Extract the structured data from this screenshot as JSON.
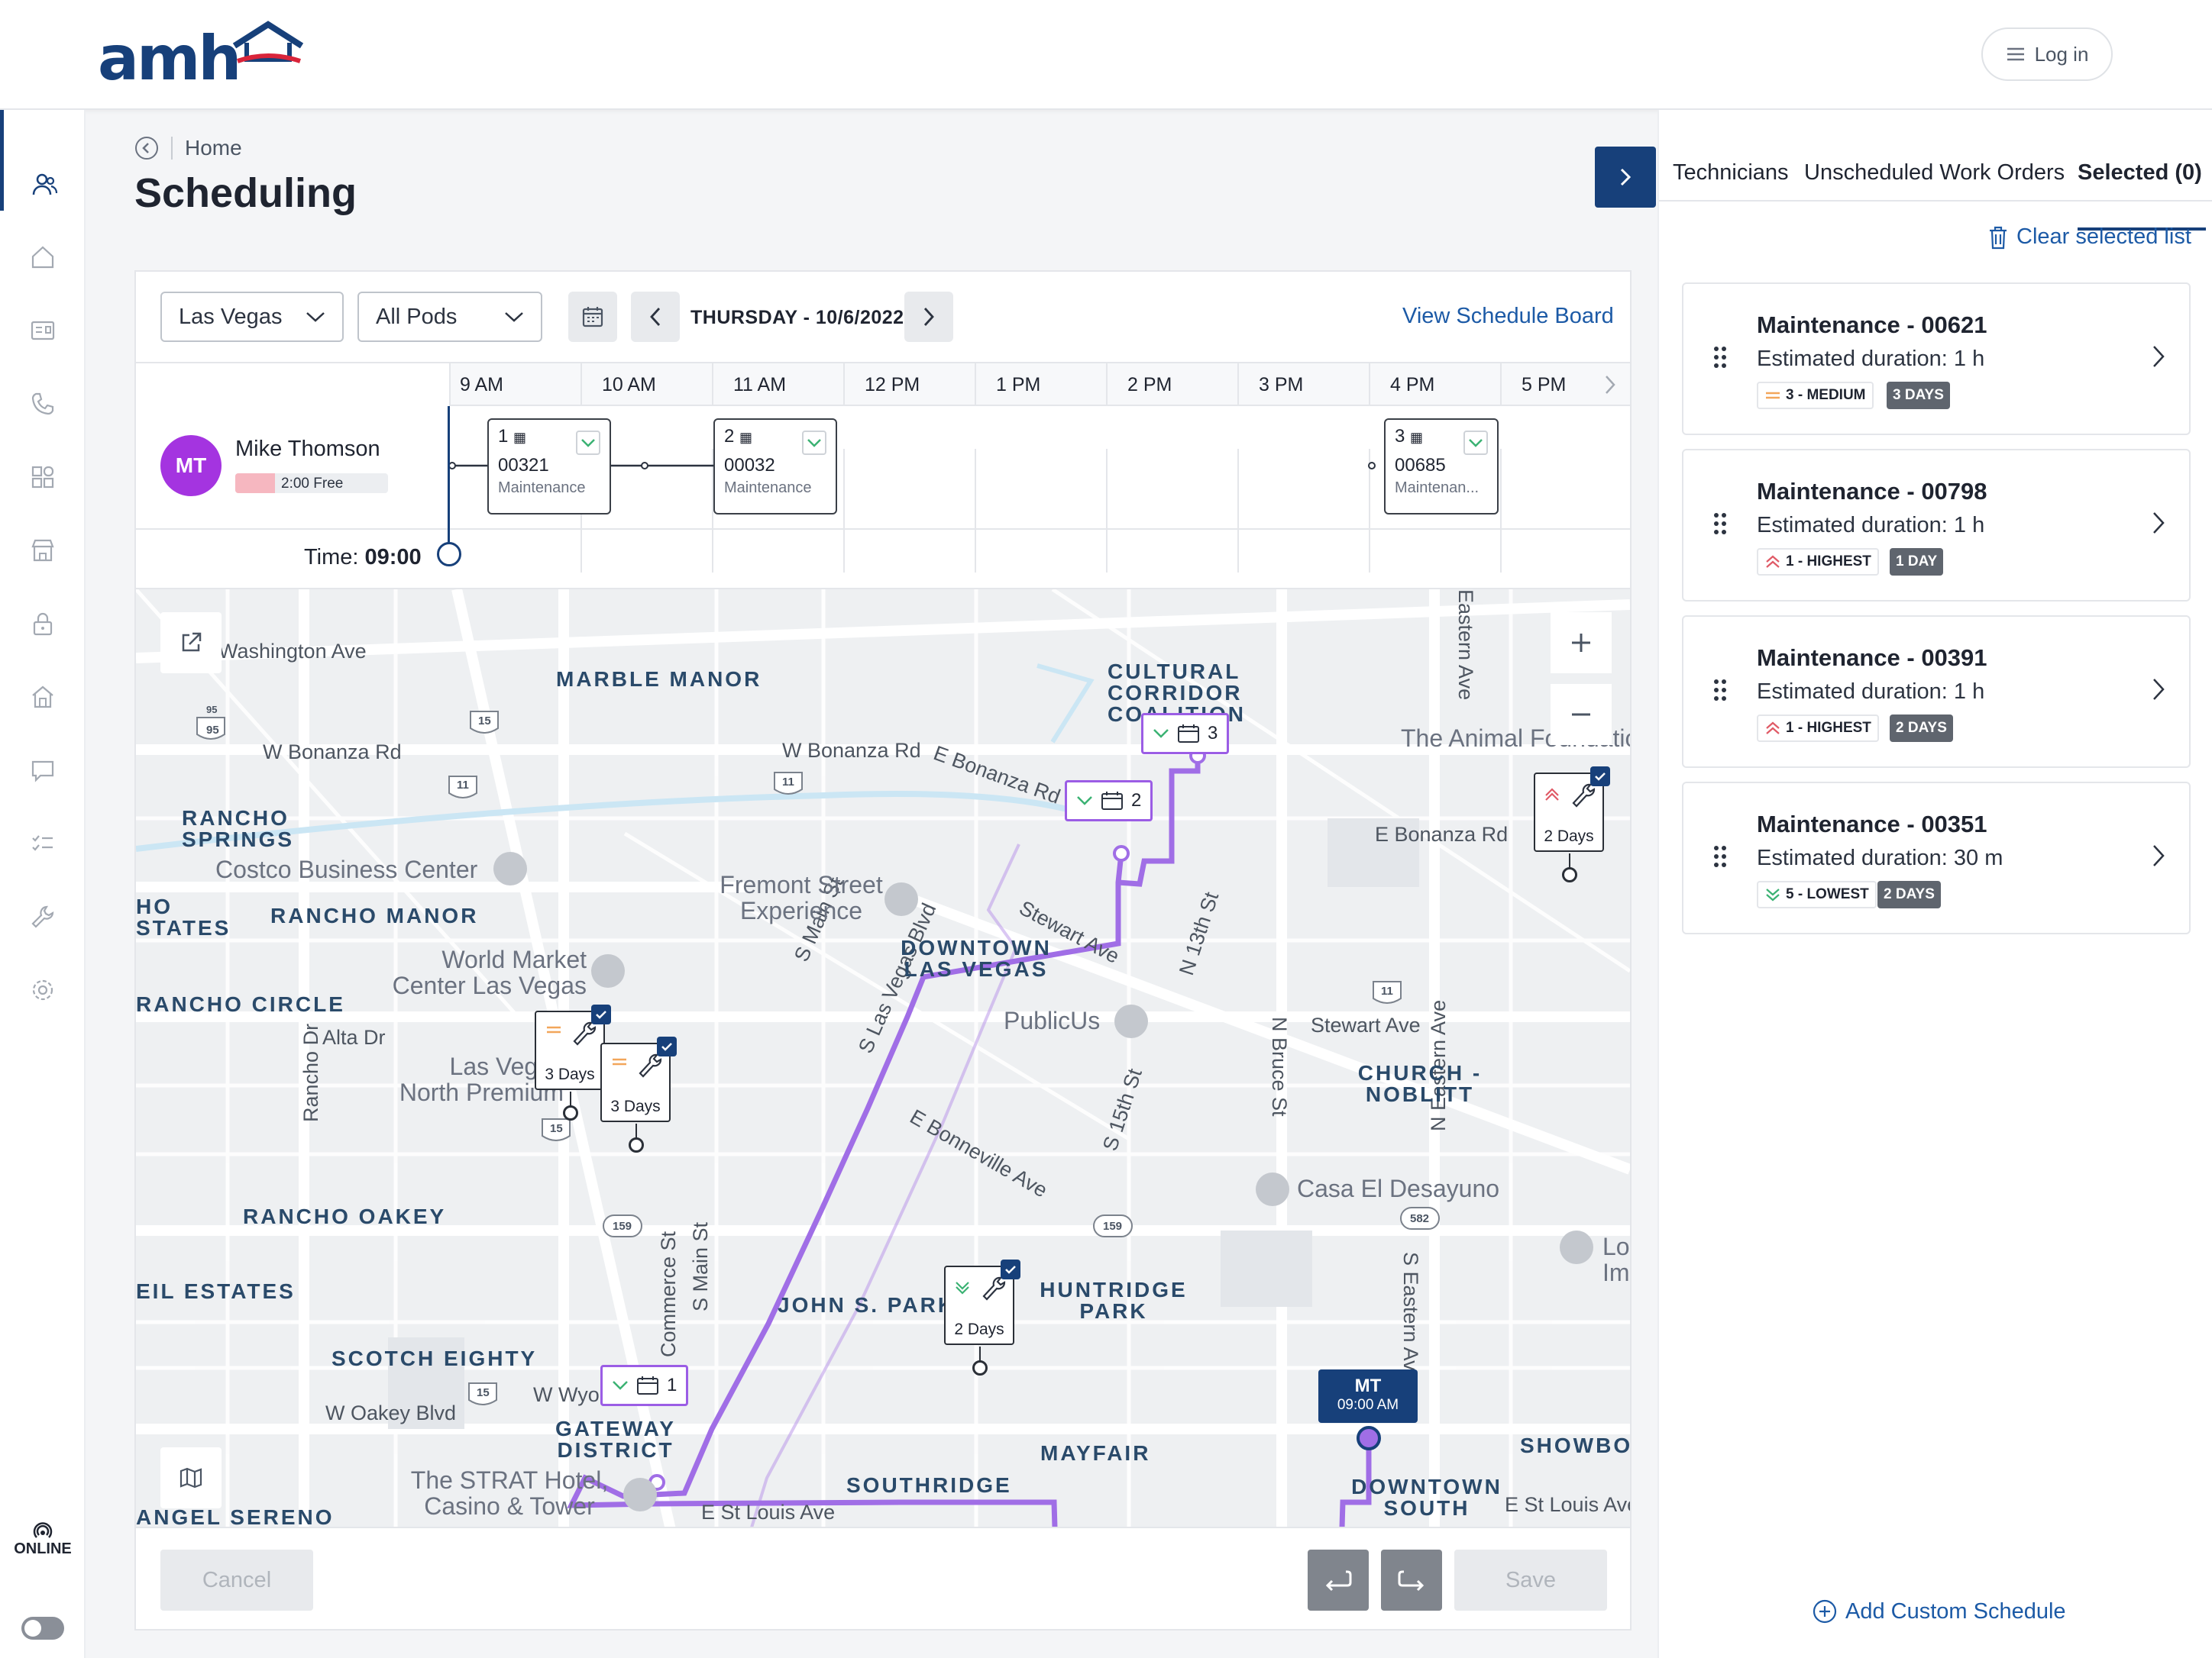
{
  "header": {
    "logo_text": "amh",
    "login_label": "Log in"
  },
  "breadcrumb": {
    "home": "Home"
  },
  "page_title": "Scheduling",
  "filters": {
    "location": "Las Vegas",
    "pods": "All Pods",
    "date": "THURSDAY - 10/6/2022",
    "view_board": "View Schedule Board"
  },
  "timeline": {
    "hours": [
      "9 AM",
      "10 AM",
      "11 AM",
      "12 PM",
      "1 PM",
      "2 PM",
      "3 PM",
      "4 PM",
      "5 PM"
    ],
    "technician": {
      "initials": "MT",
      "name": "Mike Thomson",
      "free": "2:00 Free"
    },
    "jobs": [
      {
        "num": "1",
        "code": "00321",
        "type": "Maintenance"
      },
      {
        "num": "2",
        "code": "00032",
        "type": "Maintenance"
      },
      {
        "num": "3",
        "code": "00685",
        "type": "Maintenan..."
      }
    ],
    "time_prefix": "Time:",
    "time_value": "09:00"
  },
  "map": {
    "streets": [
      "Washington Ave",
      "W Bonanza Rd",
      "W Bonanza Rd",
      "E Bonanza Rd",
      "E Bonanza Rd",
      "Stewart Ave",
      "Stewart Ave",
      "Alta Dr",
      "W Oakey Blvd",
      "E St Louis Ave",
      "E St Louis Ave",
      "E Bonneville Ave",
      "S Las Vegas Blvd",
      "S Main St",
      "N 13th St",
      "S 15th St",
      "N Bruce St",
      "N Eastern Ave",
      "S Eastern Ave",
      "Eastern Ave",
      "Rancho Dr",
      "Commerce St",
      "S Main St",
      "W Wyo"
    ],
    "neighborhoods": [
      "MARBLE MANOR",
      "CULTURAL CORRIDOR COALITION",
      "RANCHO SPRINGS",
      "RANCHO MANOR",
      "HO STATES",
      "RANCHO CIRCLE",
      "DOWNTOWN LAS VEGAS",
      "CHURCH - NOBLITT",
      "RANCHO OAKEY",
      "EIL ESTATES",
      "SCOTCH EIGHTY",
      "JOHN S. PARK",
      "HUNTRIDGE PARK",
      "GATEWAY DISTRICT",
      "MAYFAIR",
      "SOUTHRIDGE",
      "SHOWBOAT",
      "DOWNTOWN SOUTH",
      "ANGEL SERENO"
    ],
    "pois": [
      "Costco Business Center",
      "Fremont Street Experience",
      "World Market Center Las Vegas",
      "Las Vegas North Premium Outlets",
      "PublicUs",
      "Casa El Desayuno",
      "The STRAT Hotel, Casino & Tower",
      "The Animal Foundation",
      "Lo Im"
    ],
    "route_stops": [
      "1",
      "2",
      "3"
    ],
    "work_orders": [
      "3 Days",
      "3 Days",
      "2 Days",
      "2 Days"
    ],
    "tech_marker": {
      "initials": "MT",
      "time": "09:00 AM"
    },
    "highway_labels": [
      "95",
      "95",
      "15",
      "15",
      "15",
      "11",
      "11",
      "11",
      "159",
      "159",
      "582"
    ]
  },
  "footer": {
    "cancel": "Cancel",
    "save": "Save"
  },
  "right_panel": {
    "tabs": [
      "Technicians",
      "Unscheduled Work Orders",
      "Selected (0)"
    ],
    "clear_label": "Clear selected list",
    "work_orders": [
      {
        "title": "Maintenance - 00621",
        "duration": "Estimated duration: 1 h",
        "priority": "3 - MEDIUM",
        "days": "3 DAYS"
      },
      {
        "title": "Maintenance - 00798",
        "duration": "Estimated duration: 1 h",
        "priority": "1 - HIGHEST",
        "days": "1 DAY"
      },
      {
        "title": "Maintenance - 00391",
        "duration": "Estimated duration: 1 h",
        "priority": "1 - HIGHEST",
        "days": "2 DAYS"
      },
      {
        "title": "Maintenance - 00351",
        "duration": "Estimated duration: 30 m",
        "priority": "5 - LOWEST",
        "days": "2 DAYS"
      }
    ],
    "add_custom": "Add Custom Schedule"
  },
  "status": {
    "online": "ONLINE"
  },
  "colors": {
    "primary": "#17407a",
    "route": "#9b5de5",
    "link": "#1c5aa6",
    "avatar": "#a434e0",
    "medium": "#f2a65a",
    "highest": "#e05a66",
    "lowest": "#3bb273"
  }
}
